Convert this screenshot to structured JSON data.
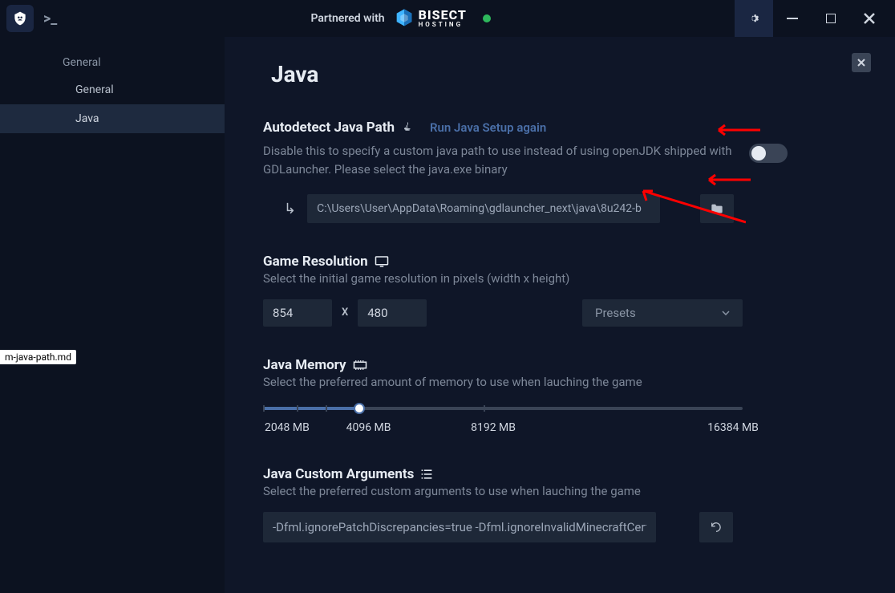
{
  "titlebar": {
    "partnered_label": "Partnered with",
    "brand_top": "BISECT",
    "brand_bot": "HOSTING"
  },
  "sidebar": {
    "section": "General",
    "items": [
      {
        "label": "General",
        "active": false
      },
      {
        "label": "Java",
        "active": true
      }
    ]
  },
  "page": {
    "title": "Java"
  },
  "autodetect": {
    "title": "Autodetect Java Path",
    "link": "Run Java Setup again",
    "desc": "Disable this to specify a custom java path to use instead of using openJDK shipped with GDLauncher. Please select the java.exe binary",
    "path_value": "C:\\Users\\User\\AppData\\Roaming\\gdlauncher_next\\java\\8u242-b"
  },
  "resolution": {
    "title": "Game Resolution",
    "desc": "Select the initial game resolution in pixels (width x height)",
    "width": "854",
    "x": "X",
    "height": "480",
    "presets_label": "Presets"
  },
  "memory": {
    "title": "Java Memory",
    "desc": "Select the preferred amount of memory to use when lauching the game",
    "labels": [
      "2048 MB",
      "4096 MB",
      "8192 MB",
      "16384 MB"
    ],
    "value_percent": 20
  },
  "args": {
    "title": "Java Custom Arguments",
    "desc": "Select the preferred custom arguments to use when lauching the game",
    "value": "-Dfml.ignorePatchDiscrepancies=true -Dfml.ignoreInvalidMinecraftCerti"
  },
  "file_tab": "m-java-path.md"
}
